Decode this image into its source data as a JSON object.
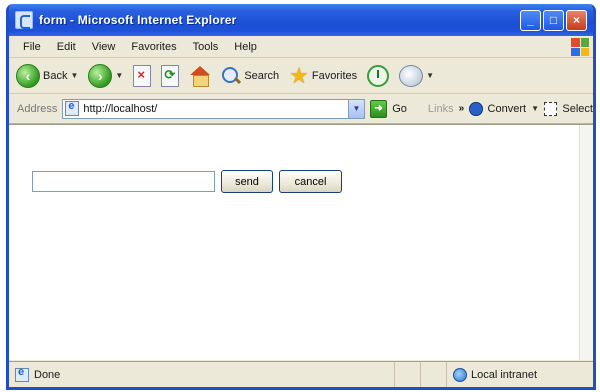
{
  "window": {
    "title": "form - Microsoft Internet Explorer",
    "controls": {
      "minimize": "_",
      "maximize": "□",
      "close": "×"
    }
  },
  "menu": [
    "File",
    "Edit",
    "View",
    "Favorites",
    "Tools",
    "Help"
  ],
  "toolbar": {
    "back_label": "Back",
    "search_label": "Search",
    "favorites_label": "Favorites",
    "icons": [
      "back-icon",
      "forward-icon",
      "stop-icon",
      "refresh-icon",
      "home-icon",
      "search-icon",
      "star-icon",
      "history-icon",
      "mail-icon"
    ]
  },
  "address": {
    "label": "Address",
    "url": "http://localhost/",
    "go_label": "Go",
    "links_label": "Links",
    "convert_label": "Convert",
    "select_label": "Select"
  },
  "form": {
    "input_value": "",
    "send_label": "send",
    "cancel_label": "cancel"
  },
  "status": {
    "text": "Done",
    "zone": "Local intranet"
  }
}
